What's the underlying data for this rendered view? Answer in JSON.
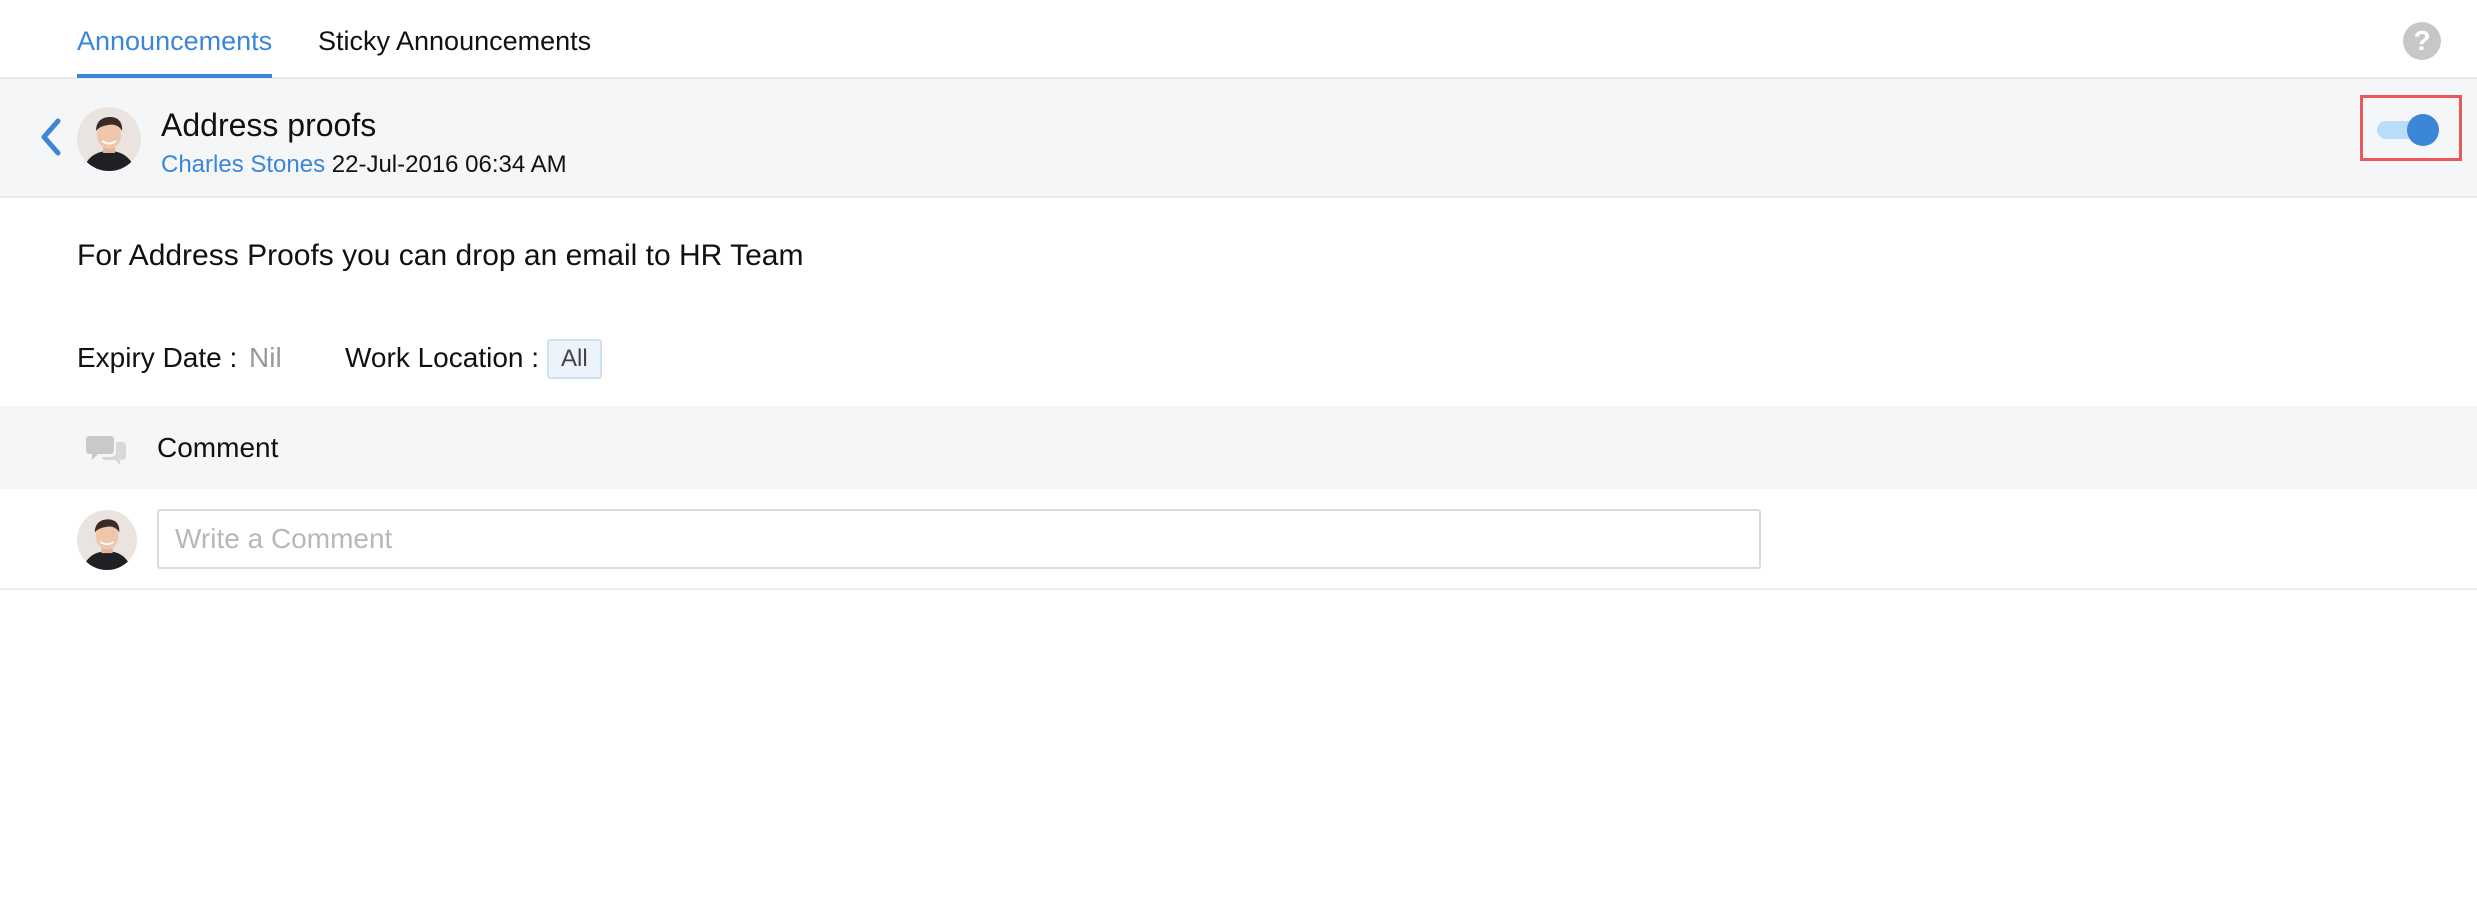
{
  "tabs": [
    {
      "label": "Announcements",
      "active": true
    },
    {
      "label": "Sticky Announcements",
      "active": false
    }
  ],
  "help_icon": {
    "glyph": "?",
    "name": "help-icon"
  },
  "announcement": {
    "title": "Address proofs",
    "author": "Charles Stones",
    "datetime": "22-Jul-2016 06:34 AM",
    "sticky_toggle_on": true,
    "message": "For Address Proofs you can drop an email to HR Team",
    "expiry_label": "Expiry Date :",
    "expiry_value": "Nil",
    "location_label": "Work Location :",
    "location_value": "All"
  },
  "comments": {
    "label": "Comment",
    "input_placeholder": "Write a Comment"
  },
  "colors": {
    "accent": "#3b86d6",
    "highlight_border": "#e8595a",
    "toggle_track": "#b9dcf8",
    "panel_bg": "#f5f6f8"
  }
}
